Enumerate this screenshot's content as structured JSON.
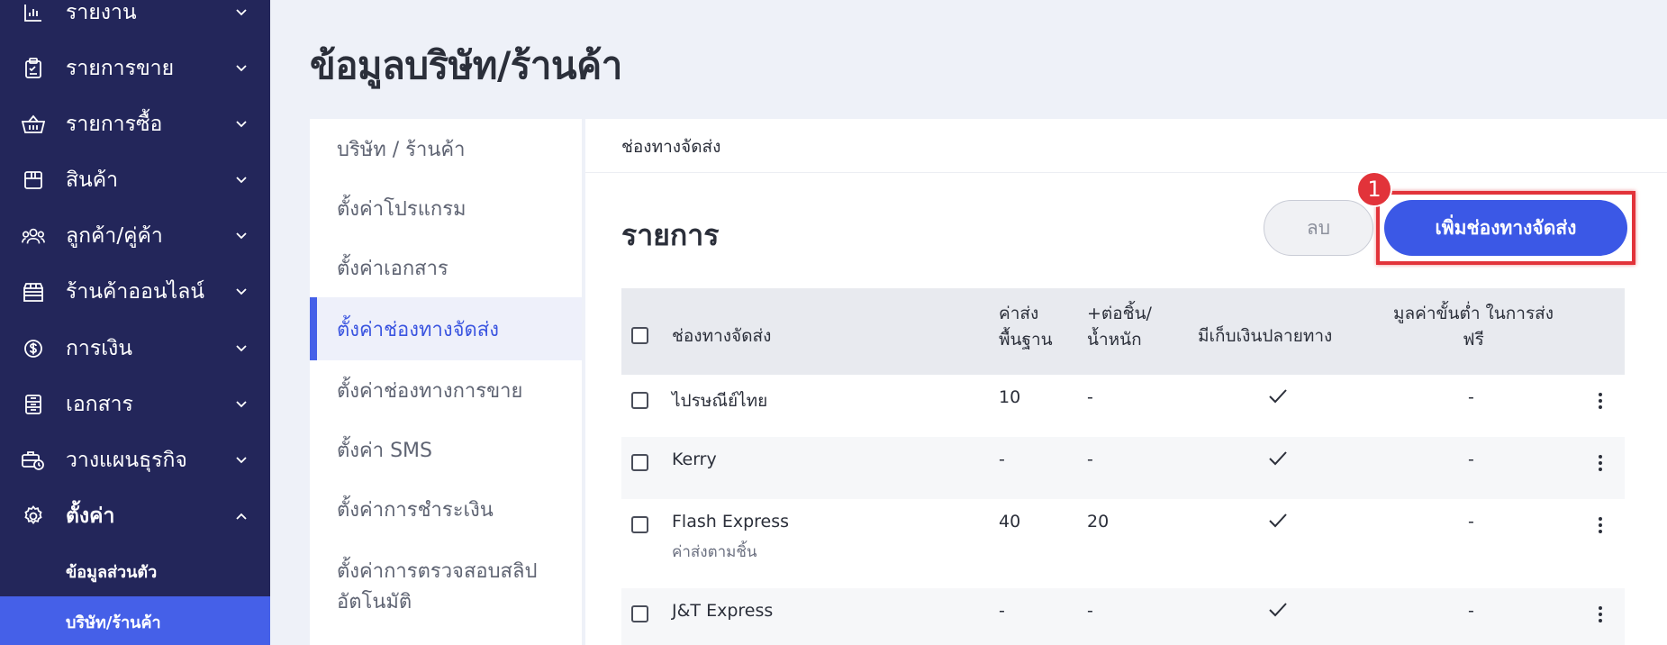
{
  "sidebar": {
    "items": [
      {
        "label": "รายงาน",
        "icon": "bar-chart-icon"
      },
      {
        "label": "รายการขาย",
        "icon": "clipboard-icon"
      },
      {
        "label": "รายการซื้อ",
        "icon": "basket-icon"
      },
      {
        "label": "สินค้า",
        "icon": "box-icon"
      },
      {
        "label": "ลูกค้า/คู่ค้า",
        "icon": "users-icon"
      },
      {
        "label": "ร้านค้าออนไลน์",
        "icon": "store-icon"
      },
      {
        "label": "การเงิน",
        "icon": "dollar-circle-icon"
      },
      {
        "label": "เอกสาร",
        "icon": "document-icon"
      },
      {
        "label": "วางแผนธุรกิจ",
        "icon": "briefcase-clock-icon"
      },
      {
        "label": "ตั้งค่า",
        "icon": "gear-icon"
      }
    ],
    "sub_items": [
      {
        "label": "ข้อมูลส่วนตัว"
      },
      {
        "label": "บริษัท/ร้านค้า"
      }
    ]
  },
  "page": {
    "title": "ข้อมูลบริษัท/ร้านค้า"
  },
  "settings_menu": {
    "items": [
      {
        "label": "บริษัท / ร้านค้า"
      },
      {
        "label": "ตั้งค่าโปรแกรม"
      },
      {
        "label": "ตั้งค่าเอกสาร"
      },
      {
        "label": "ตั้งค่าช่องทางจัดส่ง"
      },
      {
        "label": "ตั้งค่าช่องทางการขาย"
      },
      {
        "label": "ตั้งค่า SMS"
      },
      {
        "label": "ตั้งค่าการชำระเงิน"
      },
      {
        "label": "ตั้งค่าการตรวจสอบสลิป",
        "label2": "อัตโนมัติ"
      }
    ]
  },
  "panel": {
    "header": "ช่องทางจัดส่ง",
    "list_title": "รายการ",
    "delete_label": "ลบ",
    "add_label": "เพิ่มช่องทางจัดส่ง",
    "step_number": "1"
  },
  "table": {
    "columns": {
      "name": "ช่องทางจัดส่ง",
      "base_fee_1": "ค่าส่ง",
      "base_fee_2": "พื้นฐาน",
      "per_item_1": "+ต่อชิ้น/",
      "per_item_2": "น้ำหนัก",
      "cod": "มีเก็บเงินปลายทาง",
      "free_min_1": "มูลค่าขั้นต่ำ ในการส่ง",
      "free_min_2": "ฟรี"
    },
    "rows": [
      {
        "name": "ไปรษณีย์ไทย",
        "sub": "",
        "base_fee": "10",
        "per_item": "-",
        "cod": true,
        "free_min": "-"
      },
      {
        "name": "Kerry",
        "sub": "",
        "base_fee": "-",
        "per_item": "-",
        "cod": true,
        "free_min": "-"
      },
      {
        "name": "Flash Express",
        "sub": "ค่าส่งตามชิ้น",
        "base_fee": "40",
        "per_item": "20",
        "cod": true,
        "free_min": "-"
      },
      {
        "name": "J&T Express",
        "sub": "",
        "base_fee": "-",
        "per_item": "-",
        "cod": true,
        "free_min": "-"
      }
    ]
  },
  "colors": {
    "sidebar_bg": "#23265a",
    "accent": "#4560e8",
    "highlight": "#e2333a"
  }
}
